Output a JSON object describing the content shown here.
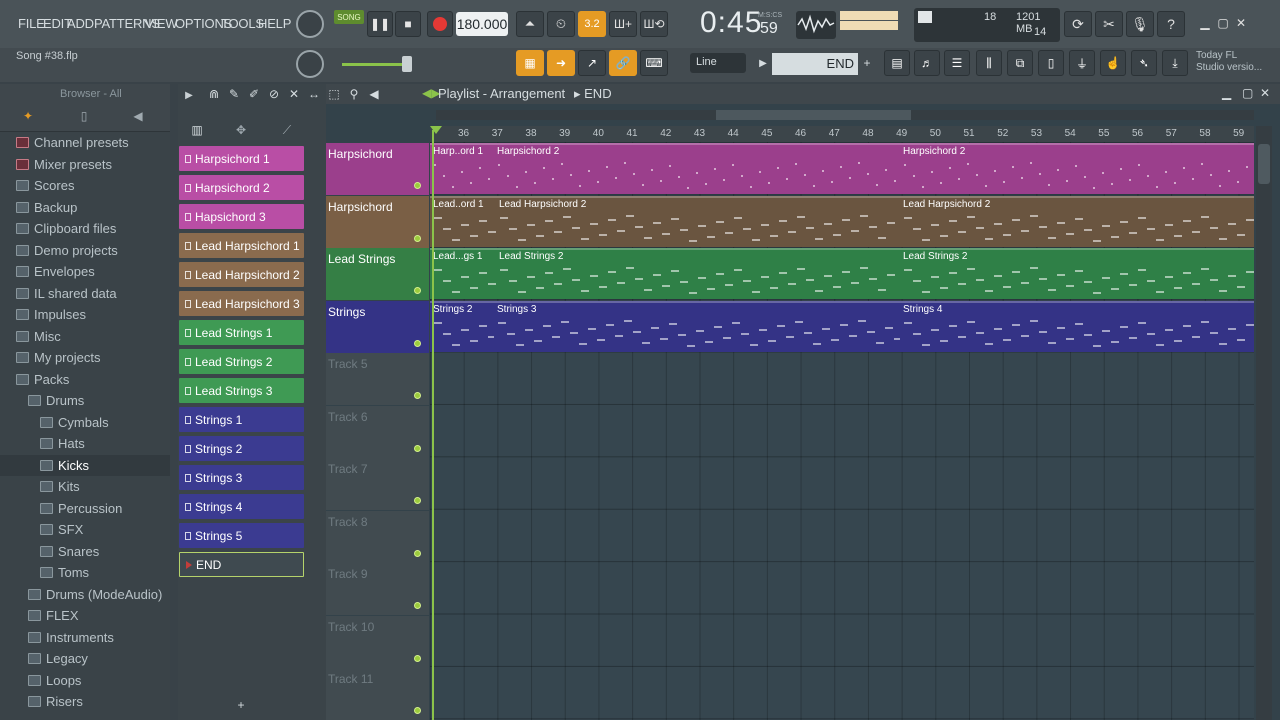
{
  "menu": [
    "FILE",
    "EDIT",
    "ADD",
    "PATTERNS",
    "VIEW",
    "OPTIONS",
    "TOOLS",
    "HELP"
  ],
  "transport": {
    "song_mode": "SONG",
    "tempo": "180.000",
    "time": "0:45",
    "time_sub": "59",
    "time_unit": "M:S:CS"
  },
  "monitor": {
    "cpu": "18",
    "ram": "1201 MB",
    "poly": "14"
  },
  "song_name": "Song #38.flp",
  "snap": {
    "mode": "Line",
    "end": "END"
  },
  "news": {
    "line1": "Today  FL",
    "line2": "Studio versio..."
  },
  "browser": {
    "title": "Browser - All",
    "items": [
      {
        "label": "Channel presets",
        "indent": 0
      },
      {
        "label": "Mixer presets",
        "indent": 0
      },
      {
        "label": "Scores",
        "indent": 0
      },
      {
        "label": "Backup",
        "indent": 0
      },
      {
        "label": "Clipboard files",
        "indent": 0
      },
      {
        "label": "Demo projects",
        "indent": 0
      },
      {
        "label": "Envelopes",
        "indent": 0
      },
      {
        "label": "IL shared data",
        "indent": 0
      },
      {
        "label": "Impulses",
        "indent": 0
      },
      {
        "label": "Misc",
        "indent": 0
      },
      {
        "label": "My projects",
        "indent": 0
      },
      {
        "label": "Packs",
        "indent": 0
      },
      {
        "label": "Drums",
        "indent": 1
      },
      {
        "label": "Cymbals",
        "indent": 2
      },
      {
        "label": "Hats",
        "indent": 2
      },
      {
        "label": "Kicks",
        "indent": 2
      },
      {
        "label": "Kits",
        "indent": 2
      },
      {
        "label": "Percussion",
        "indent": 2
      },
      {
        "label": "SFX",
        "indent": 2
      },
      {
        "label": "Snares",
        "indent": 2
      },
      {
        "label": "Toms",
        "indent": 2
      },
      {
        "label": "Drums (ModeAudio)",
        "indent": 1
      },
      {
        "label": "FLEX",
        "indent": 1
      },
      {
        "label": "Instruments",
        "indent": 1
      },
      {
        "label": "Legacy",
        "indent": 1
      },
      {
        "label": "Loops",
        "indent": 1
      },
      {
        "label": "Risers",
        "indent": 1
      }
    ]
  },
  "patterns": [
    {
      "label": "Harpsichord 1",
      "color": "#b94ea5"
    },
    {
      "label": "Harpsichord 2",
      "color": "#b94ea5"
    },
    {
      "label": "Hapsichord 3",
      "color": "#b94ea5"
    },
    {
      "label": "Lead Harpsichord 1",
      "color": "#8a6b4e"
    },
    {
      "label": "Lead Harpsichord 2",
      "color": "#8a6b4e"
    },
    {
      "label": "Lead Harpsichord 3",
      "color": "#8a6b4e"
    },
    {
      "label": "Lead Strings 1",
      "color": "#3f9a54"
    },
    {
      "label": "Lead Strings 2",
      "color": "#3f9a54"
    },
    {
      "label": "Lead Strings 3",
      "color": "#3f9a54"
    },
    {
      "label": "Strings 1",
      "color": "#3b3b91"
    },
    {
      "label": "Strings 2",
      "color": "#3b3b91"
    },
    {
      "label": "Strings 3",
      "color": "#3b3b91"
    },
    {
      "label": "Strings 4",
      "color": "#3b3b91"
    },
    {
      "label": "Strings 5",
      "color": "#3b3b91"
    },
    {
      "label": "END",
      "color": "#3f4a50"
    }
  ],
  "playlist": {
    "title": "Playlist - Arrangement",
    "marker": "END",
    "ruler": [
      "36",
      "37",
      "38",
      "39",
      "40",
      "41",
      "42",
      "43",
      "44",
      "45",
      "46",
      "47",
      "48",
      "49",
      "50",
      "51",
      "52",
      "53",
      "54",
      "55",
      "56",
      "57",
      "58",
      "59"
    ],
    "tracks": [
      {
        "label": "Harpsichord",
        "color": "#9b3f8c"
      },
      {
        "label": "Harpsichord",
        "color": "#7a5f45"
      },
      {
        "label": "Lead Strings",
        "color": "#357f45"
      },
      {
        "label": "Strings",
        "color": "#343386"
      },
      {
        "label": "Track 5",
        "color": ""
      },
      {
        "label": "Track 6",
        "color": ""
      },
      {
        "label": "Track 7",
        "color": ""
      },
      {
        "label": "Track 8",
        "color": ""
      },
      {
        "label": "Track 9",
        "color": ""
      },
      {
        "label": "Track 10",
        "color": ""
      },
      {
        "label": "Track 11",
        "color": ""
      }
    ],
    "clips": [
      {
        "track": 0,
        "label": "Harp..ord 1"
      },
      {
        "track": 0,
        "label": "Harpsichord 2"
      },
      {
        "track": 0,
        "label": "Harpsichord 2"
      },
      {
        "track": 1,
        "label": "Lead..ord 1"
      },
      {
        "track": 1,
        "label": "Lead Harpsichord 2"
      },
      {
        "track": 1,
        "label": "Lead Harpsichord 2"
      },
      {
        "track": 2,
        "label": "Lead...gs 1"
      },
      {
        "track": 2,
        "label": "Lead Strings 2"
      },
      {
        "track": 2,
        "label": "Lead Strings 2"
      },
      {
        "track": 3,
        "label": "Strings 2"
      },
      {
        "track": 3,
        "label": "Strings 3"
      },
      {
        "track": 3,
        "label": "Strings 4"
      }
    ]
  }
}
